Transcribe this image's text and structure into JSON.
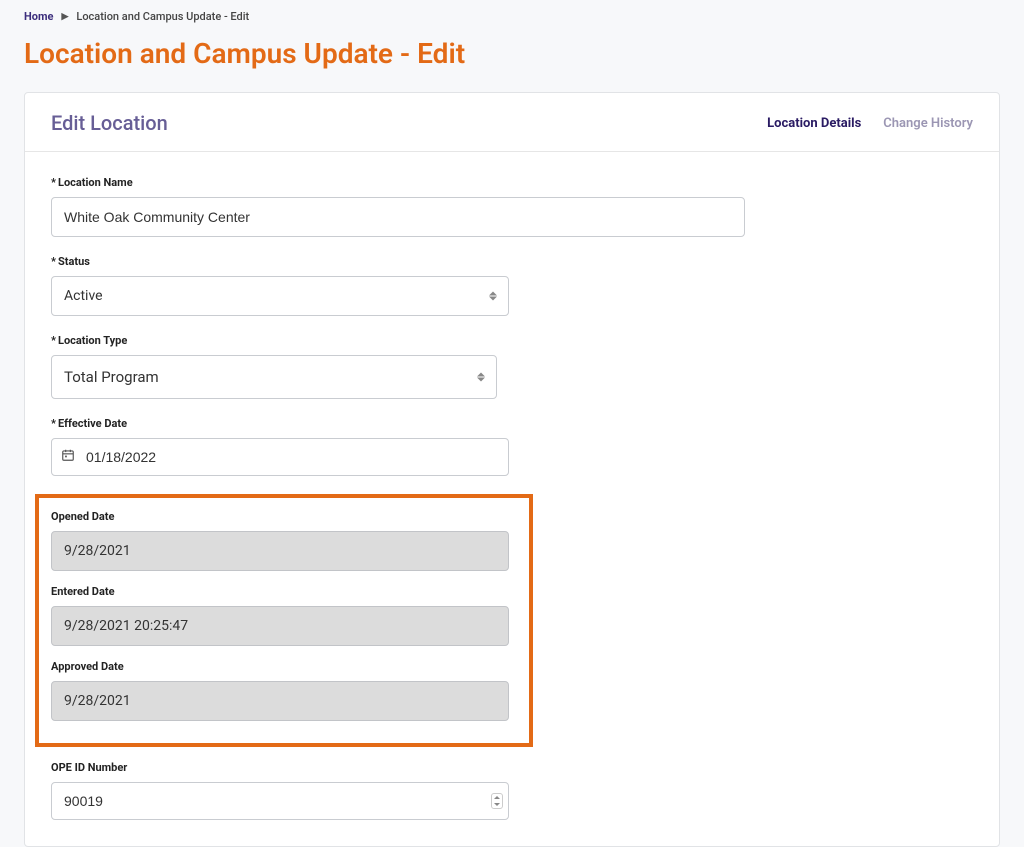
{
  "breadcrumb": {
    "home": "Home",
    "current": "Location and Campus Update - Edit"
  },
  "page_title": "Location and Campus Update - Edit",
  "card": {
    "title": "Edit Location"
  },
  "tabs": {
    "location_details": "Location Details",
    "change_history": "Change History"
  },
  "labels": {
    "location_name": "Location Name",
    "status": "Status",
    "location_type": "Location Type",
    "effective_date": "Effective Date",
    "opened_date": "Opened Date",
    "entered_date": "Entered Date",
    "approved_date": "Approved Date",
    "ope_id": "OPE ID Number",
    "req": "*"
  },
  "fields": {
    "location_name": "White Oak Community Center",
    "status": "Active",
    "location_type": "Total Program",
    "effective_date": "01/18/2022",
    "opened_date": "9/28/2021",
    "entered_date": "9/28/2021 20:25:47",
    "approved_date": "9/28/2021",
    "ope_id": "90019"
  }
}
